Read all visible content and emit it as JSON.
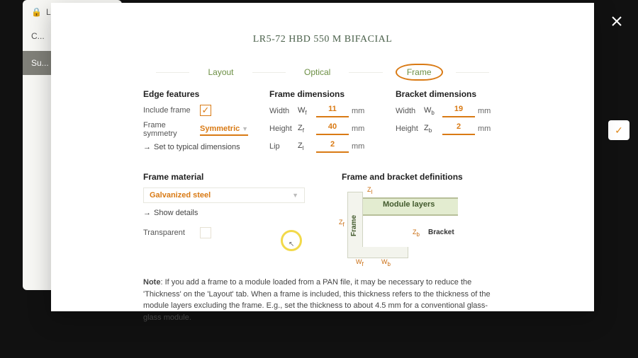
{
  "bg": {
    "label1": "Lo...",
    "label2": "C...",
    "side_tab": "Su..."
  },
  "modal": {
    "title": "LR5-72 HBD 550 M BIFACIAL",
    "tabs": {
      "layout": "Layout",
      "optical": "Optical",
      "frame": "Frame"
    },
    "sections": {
      "edge": {
        "head": "Edge features",
        "include_frame_label": "Include frame",
        "include_frame_checked": "✓",
        "symmetry_label": "Frame symmetry",
        "symmetry_value": "Symmetric",
        "set_typical": "Set to typical dimensions"
      },
      "frame_dims": {
        "head": "Frame dimensions",
        "width_label": "Width",
        "width_sym": "Wf",
        "width_val": "11",
        "width_unit": "mm",
        "height_label": "Height",
        "height_sym": "Zf",
        "height_val": "40",
        "height_unit": "mm",
        "lip_label": "Lip",
        "lip_sym": "Zl",
        "lip_val": "2",
        "lip_unit": "mm"
      },
      "bracket_dims": {
        "head": "Bracket dimensions",
        "width_label": "Width",
        "width_sym": "Wb",
        "width_val": "19",
        "width_unit": "mm",
        "height_label": "Height",
        "height_sym": "Zb",
        "height_val": "2",
        "height_unit": "mm"
      },
      "material": {
        "head": "Frame material",
        "value": "Galvanized steel",
        "show_details": "Show details",
        "transparent_label": "Transparent"
      },
      "diagram": {
        "head": "Frame and bracket definitions",
        "module_layers": "Module layers",
        "frame": "Frame",
        "bracket": "Bracket",
        "zl": "Zl",
        "zf": "Zf",
        "wf": "Wf",
        "wb": "Wb",
        "zb": "Zb"
      }
    },
    "note": {
      "prefix": "Note",
      "body": ": If you add a frame to a module loaded from a PAN file, it may be necessary to reduce the 'Thickness' on the 'Layout' tab. When a frame is included, this thickness refers to the thickness of the module layers excluding the frame. E.g., set the thickness to about 4.5 mm for a conventional glass-glass module."
    }
  }
}
